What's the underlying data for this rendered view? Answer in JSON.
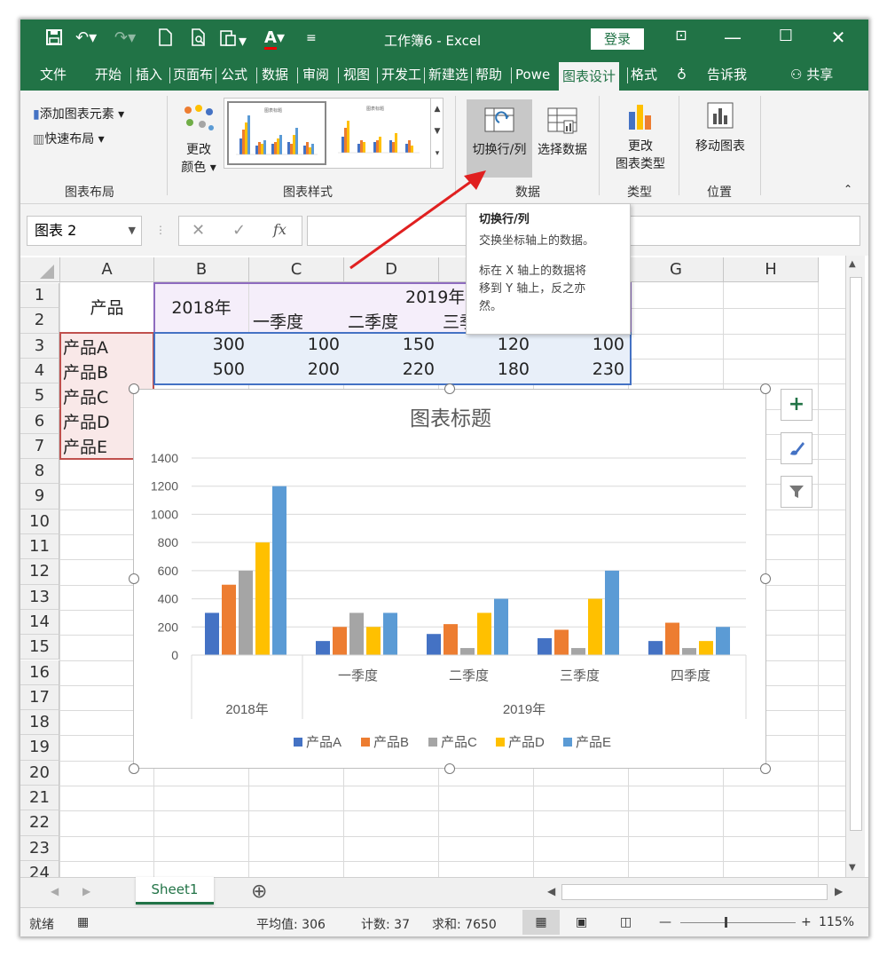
{
  "titlebar": {
    "title": "工作簿6  -  Excel",
    "login": "登录",
    "icons": [
      "save-icon",
      "undo-icon",
      "redo-icon",
      "new-doc-icon",
      "print-preview-icon",
      "paste-icon",
      "font-color-icon",
      "customize-icon"
    ],
    "window_controls": [
      "ribbon-display-icon",
      "minimize-icon",
      "maximize-icon",
      "close-icon"
    ]
  },
  "tabs": [
    "文件",
    "开始",
    "插入",
    "页面布",
    "公式",
    "数据",
    "审阅",
    "视图",
    "开发工",
    "新建选",
    "帮助",
    "Powe",
    "图表设计",
    "格式",
    "告诉我",
    "共享"
  ],
  "ribbon": {
    "add_element": "添加图表元素",
    "quick_layout": "快速布局",
    "change_colors_1": "更改",
    "change_colors_2": "颜色",
    "switch_row_col": "切换行/列",
    "select_data": "选择数据",
    "change_type_1": "更改",
    "change_type_2": "图表类型",
    "move_chart": "移动图表",
    "groups": [
      "图表布局",
      "图表样式",
      "数据",
      "类型",
      "位置"
    ]
  },
  "formula": {
    "namebox": "图表 2",
    "cancel": "✕",
    "enter": "✓",
    "fx": "fx",
    "value": ""
  },
  "columns": [
    "A",
    "B",
    "C",
    "D",
    "E",
    "F",
    "G",
    "H"
  ],
  "rows": [
    "1",
    "2",
    "3",
    "4",
    "5",
    "6",
    "7",
    "8",
    "9",
    "10",
    "11",
    "12",
    "13",
    "14",
    "15",
    "16",
    "17",
    "18",
    "19",
    "20",
    "21",
    "22",
    "23",
    "24"
  ],
  "cells": {
    "a1": "产品",
    "b1": "2018年",
    "c1": "2019年",
    "c2": "一季度",
    "d2": "二季度",
    "e2": "三季",
    "a3": "产品A",
    "b3": "300",
    "c3": "100",
    "d3": "150",
    "e3": "120",
    "f3": "100",
    "a4": "产品B",
    "b4": "500",
    "c4": "200",
    "d4": "220",
    "e4": "180",
    "f4": "230",
    "a5": "产品C",
    "a6": "产品D",
    "a7": "产品E"
  },
  "tooltip": {
    "title": "切换行/列",
    "line1": "交换坐标轴上的数据。",
    "line2": "标在 X 轴上的数据将",
    "line3": "移到 Y 轴上，反之亦",
    "line4": "然。"
  },
  "chart_data": {
    "type": "bar",
    "title": "图表标题",
    "categories": [
      "2018年",
      "一季度",
      "二季度",
      "三季度",
      "四季度"
    ],
    "category_groups": [
      {
        "label": "2018年",
        "span": 1
      },
      {
        "label": "2019年",
        "span": 4
      }
    ],
    "ylim": [
      0,
      1400
    ],
    "yticks": [
      0,
      200,
      400,
      600,
      800,
      1000,
      1200,
      1400
    ],
    "grid": true,
    "legend": "bottom",
    "series": [
      {
        "name": "产品A",
        "color": "#4472C4",
        "values": [
          300,
          100,
          150,
          120,
          100
        ]
      },
      {
        "name": "产品B",
        "color": "#ED7D31",
        "values": [
          500,
          200,
          220,
          180,
          230
        ]
      },
      {
        "name": "产品C",
        "color": "#A5A5A5",
        "values": [
          600,
          300,
          50,
          50,
          50
        ]
      },
      {
        "name": "产品D",
        "color": "#FFC000",
        "values": [
          800,
          200,
          300,
          400,
          100
        ]
      },
      {
        "name": "产品E",
        "color": "#5B9BD5",
        "values": [
          1200,
          300,
          400,
          600,
          200
        ]
      }
    ]
  },
  "sheet": {
    "name": "Sheet1",
    "add": "⊕"
  },
  "status": {
    "ready": "就绪",
    "average": "平均值: 306",
    "count": "计数: 37",
    "sum": "求和: 7650",
    "zoom": "115%"
  },
  "accent": "#217346"
}
